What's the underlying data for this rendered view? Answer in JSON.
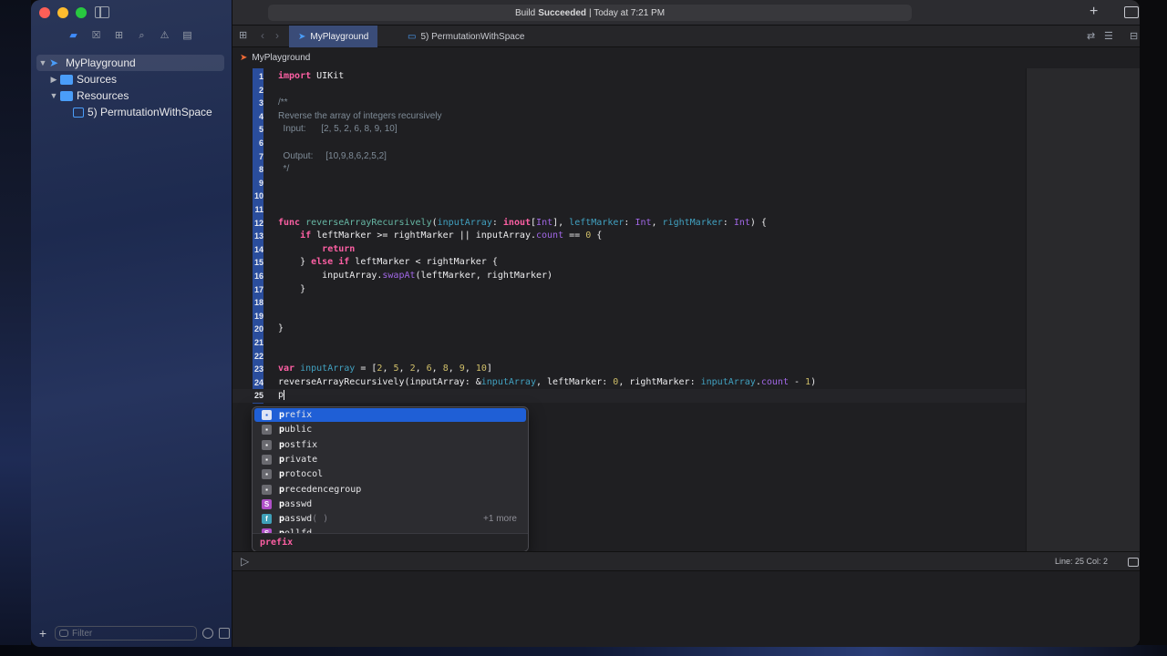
{
  "titlebar": {
    "status_prefix": "Build",
    "status_bold": "Succeeded",
    "status_suffix": "| Today at 7:21 PM"
  },
  "navigator": {
    "tree": [
      {
        "label": "MyPlayground",
        "icon": "swift-icon",
        "expanded": true
      },
      {
        "label": "Sources",
        "icon": "folder-icon",
        "expanded": false
      },
      {
        "label": "Resources",
        "icon": "folder-icon",
        "expanded": true
      },
      {
        "label": "5) PermutationWithSpace",
        "icon": "page-icon"
      }
    ],
    "filter_placeholder": "Filter"
  },
  "tabs": [
    {
      "label": "MyPlayground",
      "active": true
    },
    {
      "label": "5) PermutationWithSpace",
      "active": false
    }
  ],
  "jumpbar": {
    "path": "MyPlayground"
  },
  "editor": {
    "line_numbers": [
      "1",
      "2",
      "3",
      "4",
      "5",
      "6",
      "7",
      "8",
      "9",
      "10",
      "11",
      "12",
      "13",
      "14",
      "15",
      "16",
      "17",
      "18",
      "19",
      "20",
      "21",
      "22",
      "23",
      "24",
      "25"
    ],
    "current_line": 25,
    "typed_text": "p"
  },
  "completion": {
    "items": [
      {
        "match": "p",
        "rest": "refix",
        "kind": "keyword",
        "selected": true
      },
      {
        "match": "p",
        "rest": "ublic",
        "kind": "keyword"
      },
      {
        "match": "p",
        "rest": "ostfix",
        "kind": "keyword"
      },
      {
        "match": "p",
        "rest": "rivate",
        "kind": "keyword"
      },
      {
        "match": "p",
        "rest": "rotocol",
        "kind": "keyword"
      },
      {
        "match": "p",
        "rest": "recedencegroup",
        "kind": "keyword"
      },
      {
        "match": "p",
        "rest": "asswd",
        "kind": "struct",
        "badge": "S"
      },
      {
        "match": "p",
        "rest": "asswd",
        "suffix": "( )",
        "kind": "function",
        "badge": "f",
        "more": "+1 more"
      },
      {
        "match": "p",
        "rest": "ollfd",
        "kind": "struct",
        "badge": "S"
      }
    ],
    "footer": "prefix"
  },
  "debug": {
    "line_col": "Line: 25  Col: 2"
  },
  "colors": {
    "accent": "#1f5fd6",
    "keyword": "#fc5fa3",
    "tab_active": "#3a4c78"
  }
}
